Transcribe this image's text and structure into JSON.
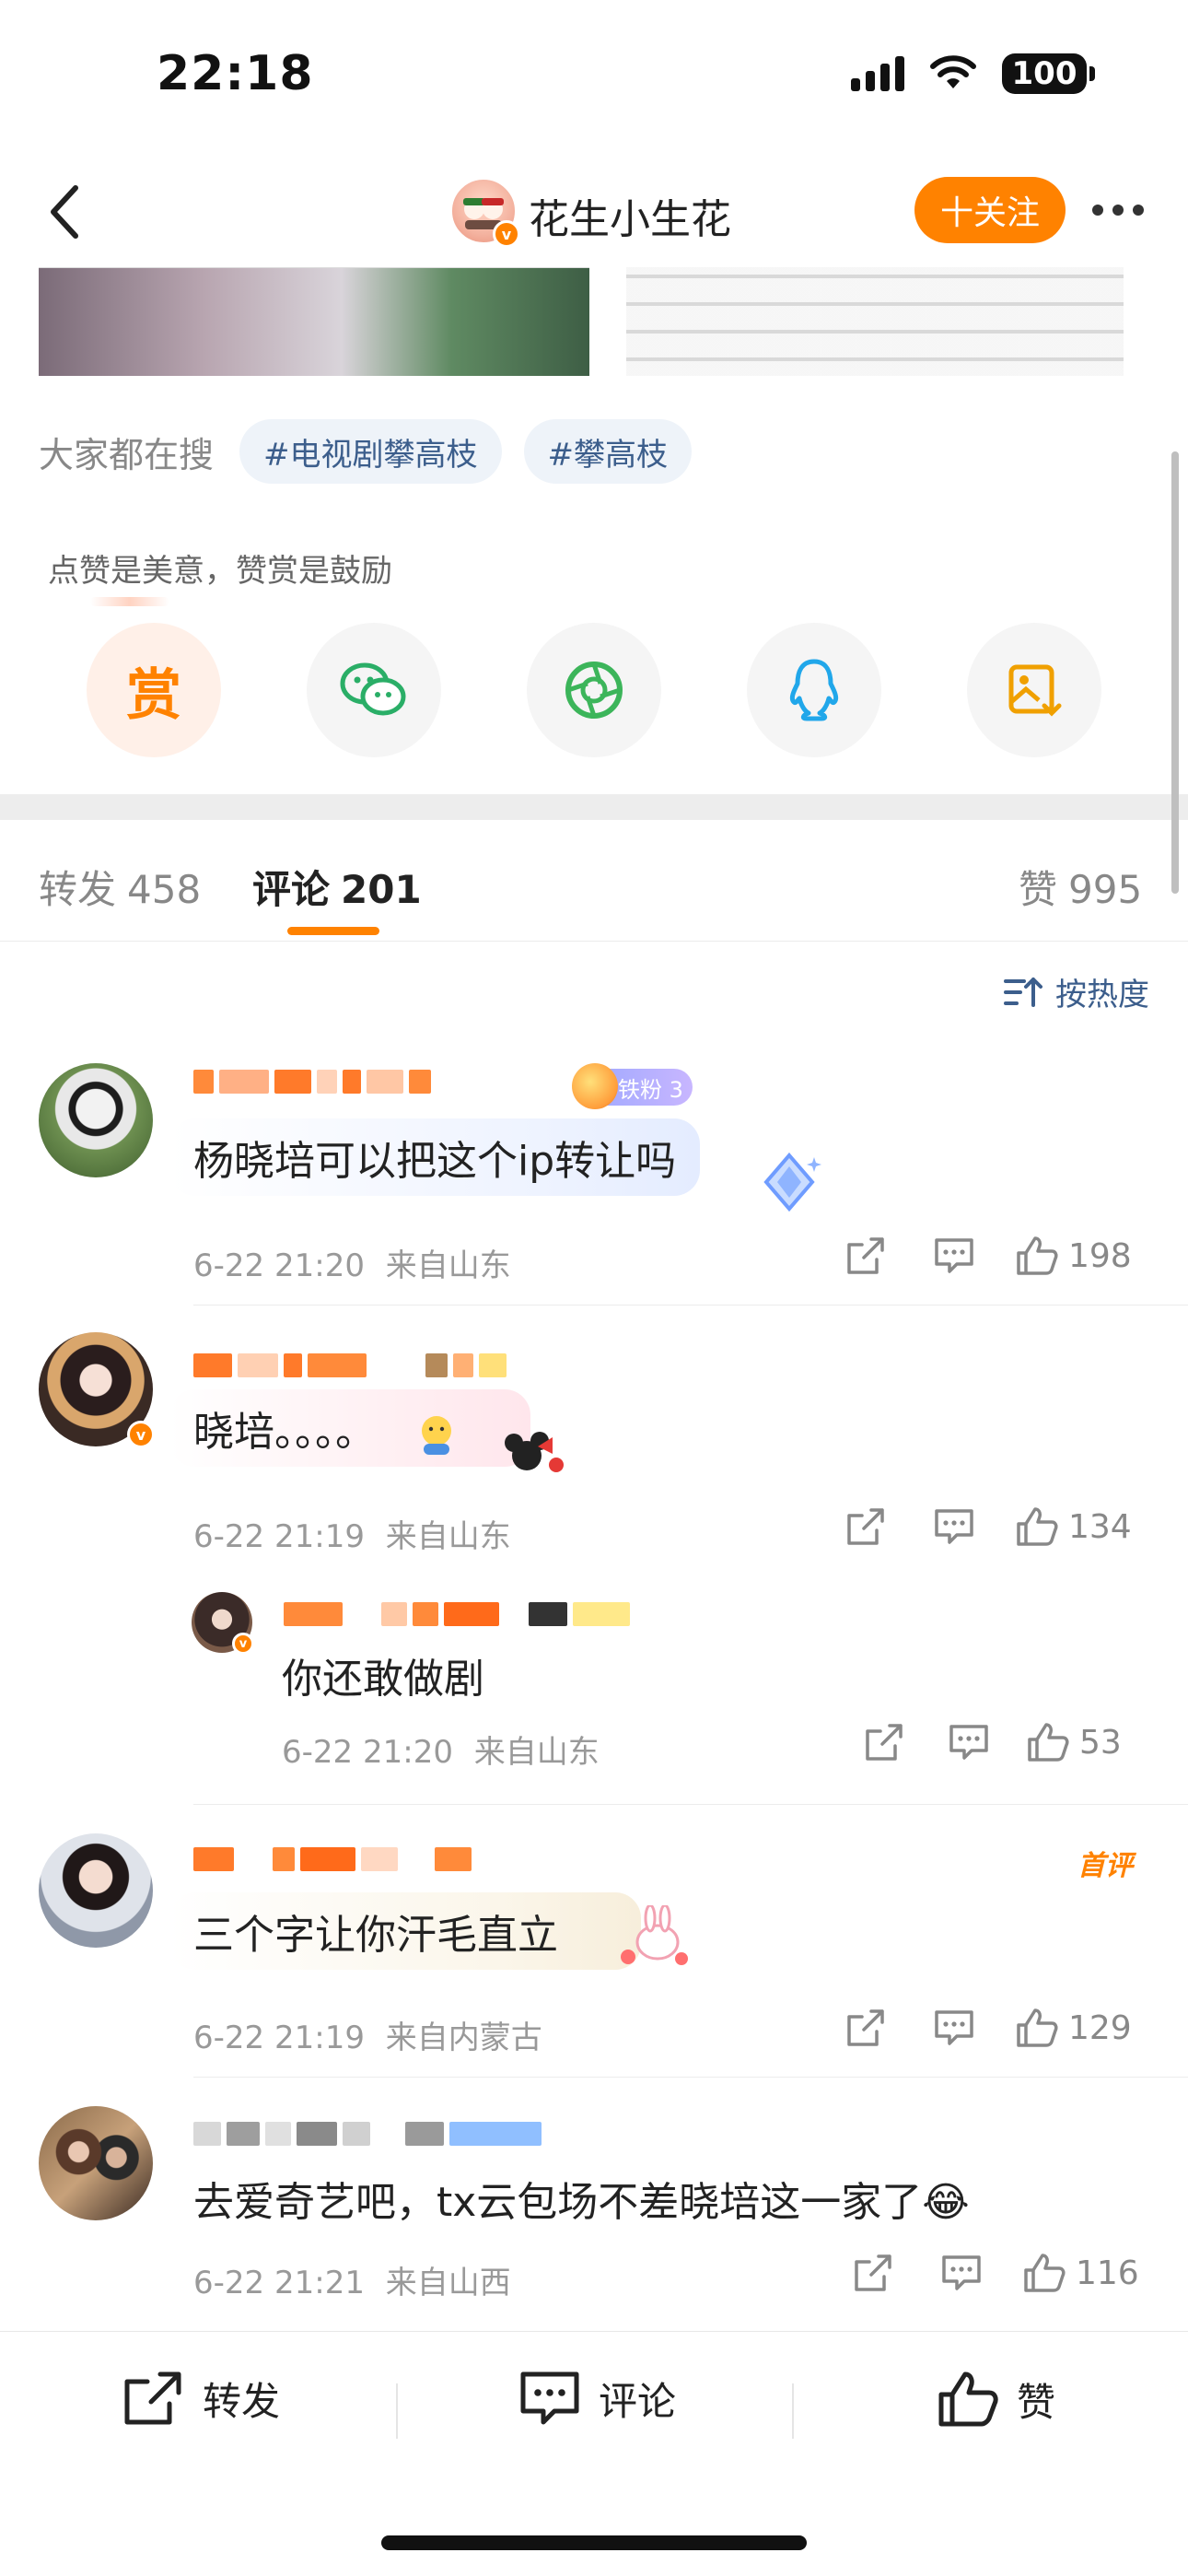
{
  "status_bar": {
    "time": "22:18",
    "battery": "100"
  },
  "nav": {
    "title": "花生小生花",
    "follow_label": "十关注"
  },
  "search": {
    "label": "大家都在搜",
    "tags": [
      "#电视剧攀高枝",
      "#攀高枝"
    ]
  },
  "reward": {
    "hint": "点赞是美意，赞赏是鼓励",
    "button_label": "赏"
  },
  "share_targets": [
    "reward-icon",
    "wechat-icon",
    "moments-icon",
    "qq-icon",
    "save-image-icon"
  ],
  "tabs": [
    {
      "label": "转发",
      "count": "458"
    },
    {
      "label": "评论",
      "count": "201"
    },
    {
      "label": "赞",
      "count": "995"
    }
  ],
  "sort_label": "按热度",
  "comments": [
    {
      "text": "杨晓培可以把这个ip转让吗",
      "time": "6-22 21:20",
      "location": "来自山东",
      "likes": "198",
      "fan_badge": "铁粉 3"
    },
    {
      "text": "晓培。。。。",
      "time": "6-22 21:19",
      "location": "来自山东",
      "likes": "134",
      "reply": {
        "text": "你还敢做剧",
        "time": "6-22 21:20",
        "location": "来自山东",
        "likes": "53"
      }
    },
    {
      "text": "三个字让你汗毛直立",
      "time": "6-22 21:19",
      "location": "来自内蒙古",
      "likes": "129",
      "badge": "首评"
    },
    {
      "text": "去爱奇艺吧，tx云包场不差晓培这一家了😂",
      "time": "6-22 21:21",
      "location": "来自山西",
      "likes": "116"
    }
  ],
  "bottom_bar": {
    "repost": "转发",
    "comment": "评论",
    "like": "赞"
  },
  "colors": {
    "accent": "#ff8200",
    "link": "#3c5e8c",
    "meta": "#999999"
  }
}
